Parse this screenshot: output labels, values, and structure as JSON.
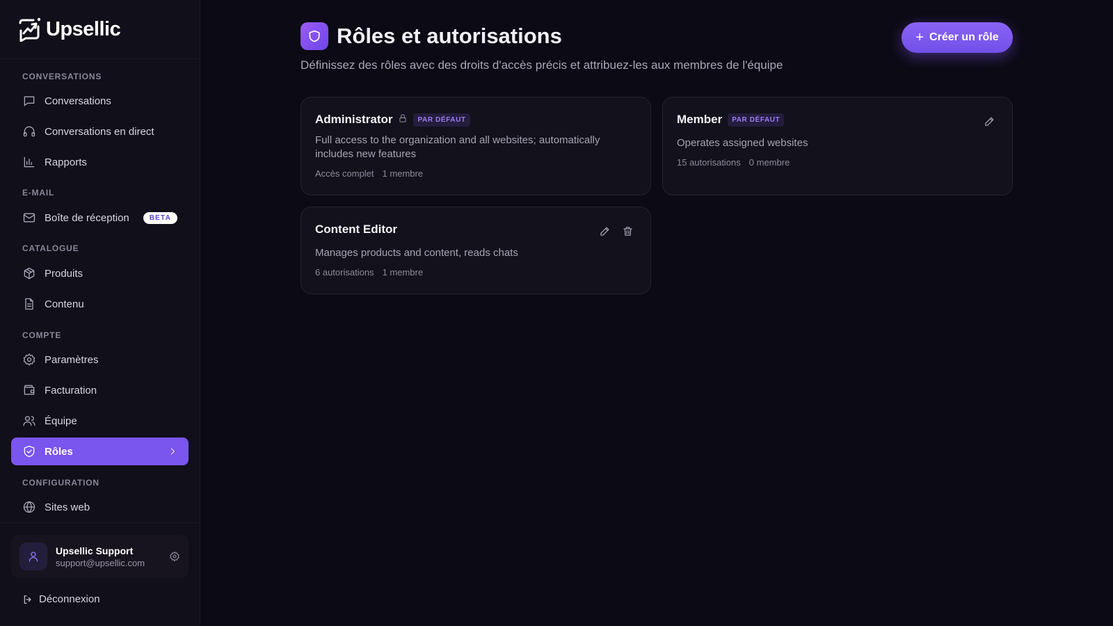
{
  "brand": {
    "name": "Upsellic"
  },
  "sidebar": {
    "sections": {
      "conversations": "CONVERSATIONS",
      "email": "E-MAIL",
      "catalog": "CATALOGUE",
      "account": "COMPTE",
      "config": "CONFIGURATION"
    },
    "items": {
      "conversations": "Conversations",
      "live": "Conversations en direct",
      "reports": "Rapports",
      "inbox": "Boîte de réception",
      "inbox_badge": "BETA",
      "products": "Produits",
      "content": "Contenu",
      "settings": "Paramètres",
      "billing": "Facturation",
      "team": "Équipe",
      "roles": "Rôles",
      "websites": "Sites web"
    },
    "active_item": "roles",
    "user": {
      "name": "Upsellic Support",
      "email": "support@upsellic.com"
    },
    "logout": "Déconnexion"
  },
  "header": {
    "title": "Rôles et autorisations",
    "subtitle": "Définissez des rôles avec des droits d'accès précis et attribuez-les aux membres de l'équipe",
    "create_button": "Créer un rôle"
  },
  "roles": [
    {
      "name": "Administrator",
      "locked": true,
      "badge": "PAR DÉFAUT",
      "description": "Full access to the organization and all websites; automatically includes new features",
      "permissions": "Accès complet",
      "members": "1 membre"
    },
    {
      "name": "Member",
      "badge": "PAR DÉFAUT",
      "description": "Operates assigned websites",
      "permissions": "15 autorisations",
      "members": "0 membre"
    },
    {
      "name": "Content Editor",
      "description": "Manages products and content, reads chats",
      "permissions": "6 autorisations",
      "members": "1 membre"
    }
  ],
  "colors": {
    "accent": "#7a55ee",
    "background": "#0c0a14",
    "sidebar": "#110f19"
  }
}
